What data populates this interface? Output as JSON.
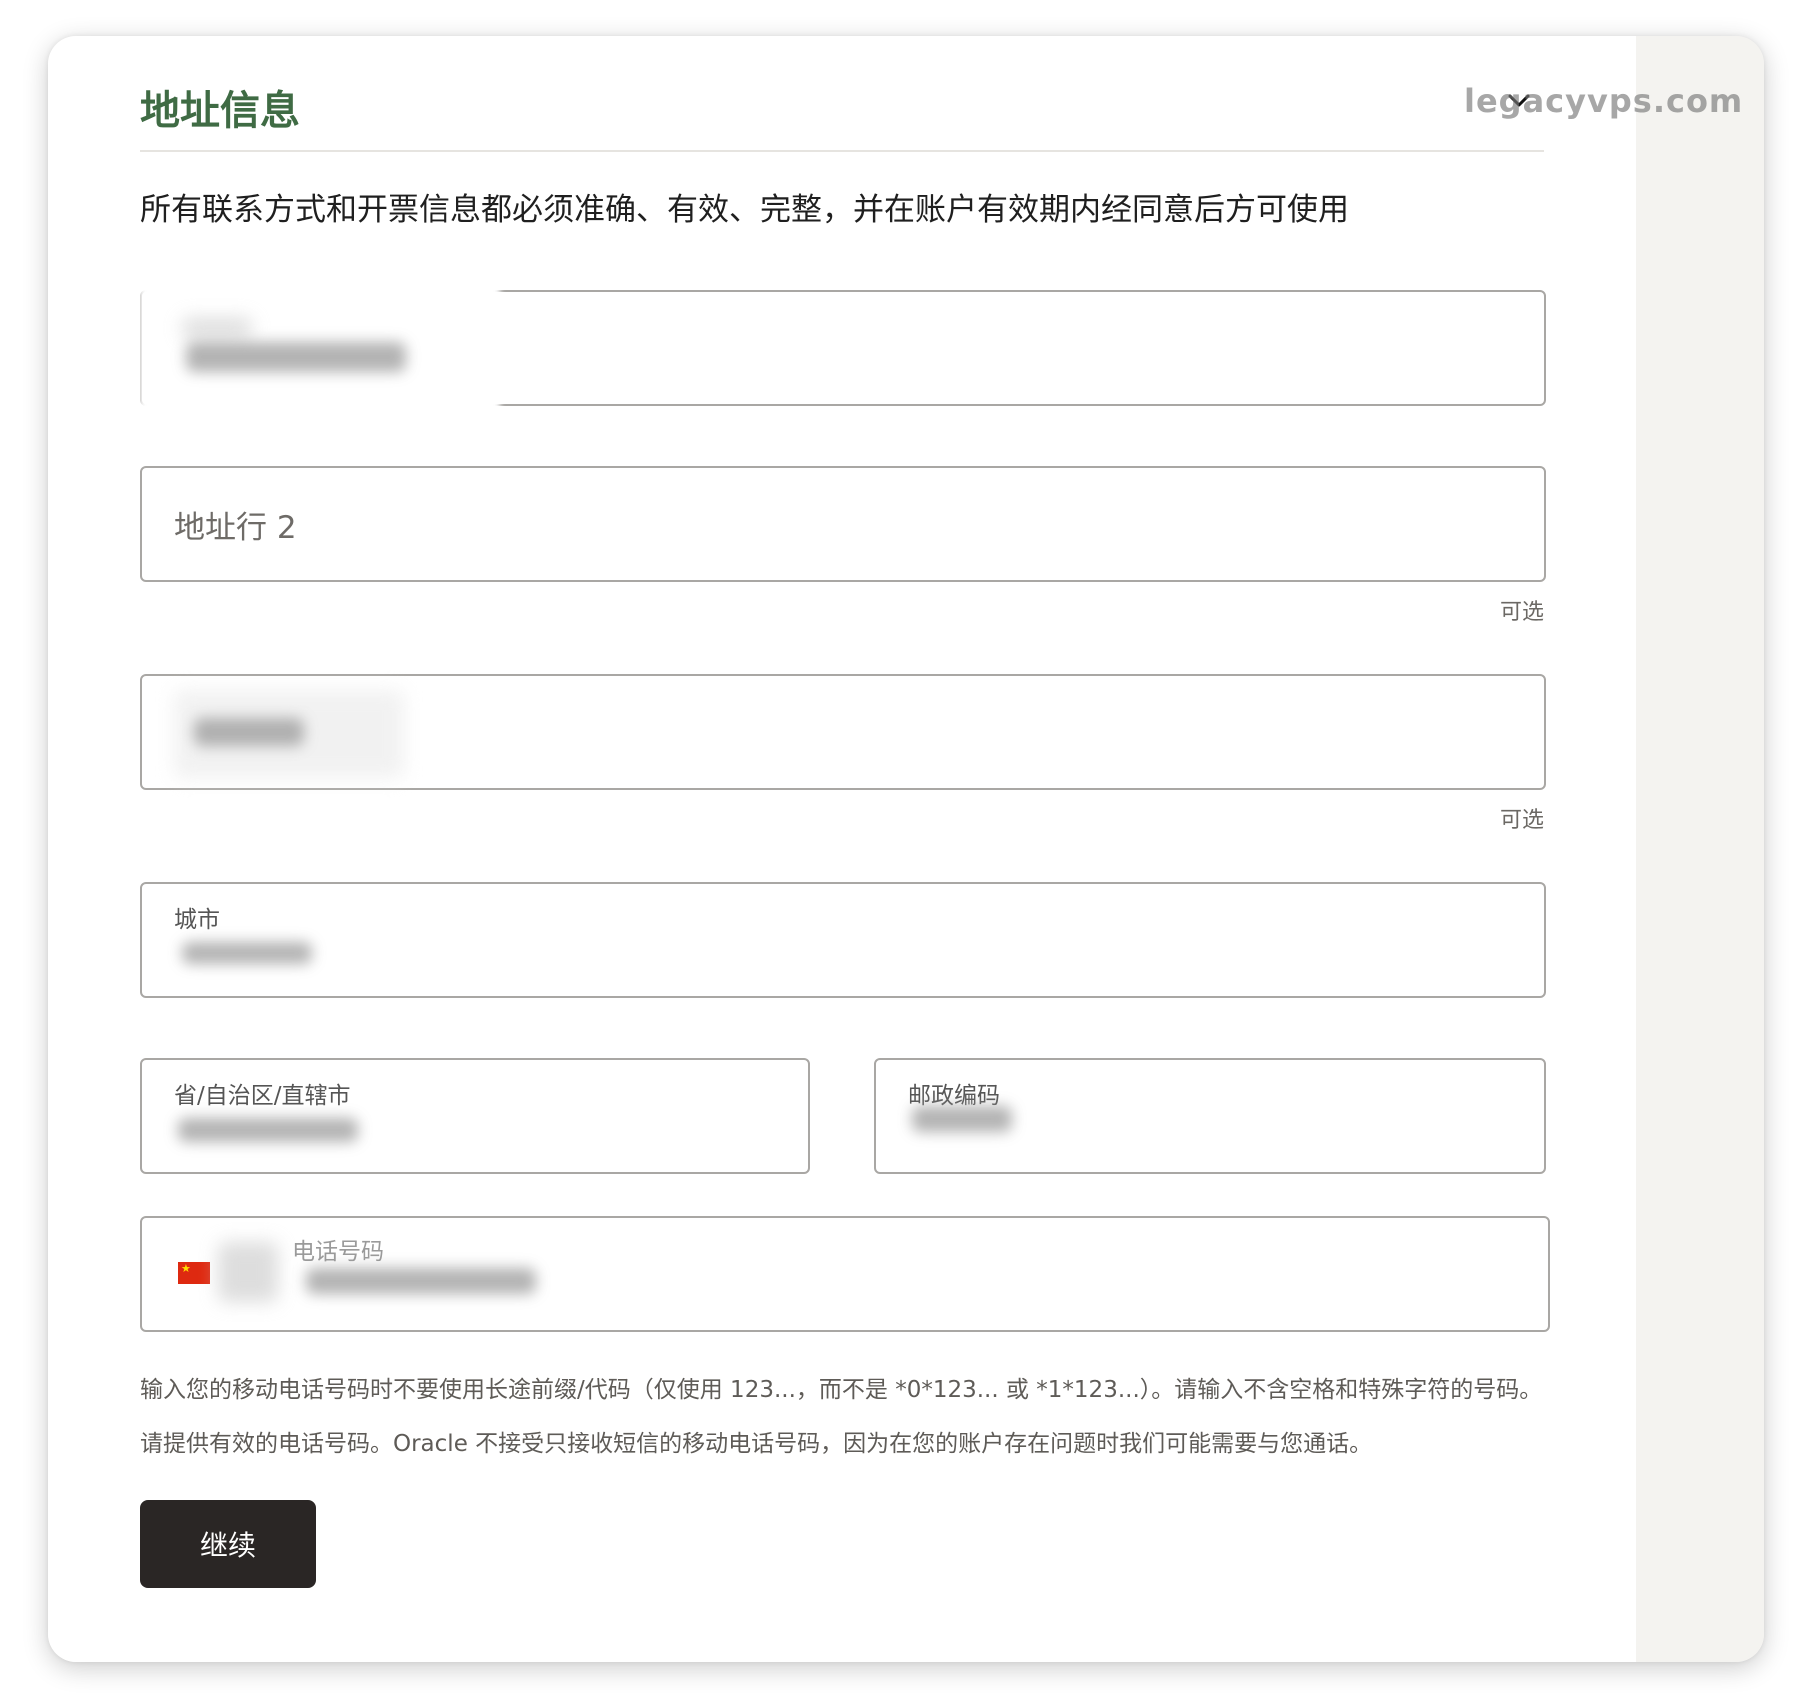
{
  "section": {
    "title": "地址信息",
    "watermark": "legacyvps.com"
  },
  "notice": "所有联系方式和开票信息都必须准确、有效、完整，并在账户有效期内经同意后方可使用",
  "fields": {
    "address_line1": {
      "value": ""
    },
    "address_line2": {
      "placeholder": "地址行 2",
      "hint": "可选"
    },
    "address_line3": {
      "hint": "可选"
    },
    "city": {
      "label": "城市"
    },
    "province": {
      "label": "省/自治区/直辖市"
    },
    "postal_code": {
      "label": "邮政编码"
    },
    "phone": {
      "label": "电话号码",
      "country_icon": "china-flag-icon"
    }
  },
  "help": {
    "line1": "输入您的移动电话号码时不要使用长途前缀/代码（仅使用 123...，而不是 *0*123... 或 *1*123...）。请输入不含空格和特殊字符的号码。",
    "line2": "请提供有效的电话号码。Oracle 不接受只接收短信的移动电话号码，因为在您的账户存在问题时我们可能需要与您通话。"
  },
  "buttons": {
    "continue": "继续"
  },
  "colors": {
    "title": "#3f6b44",
    "button": "#2a2625",
    "border": "#a9a7a4"
  }
}
